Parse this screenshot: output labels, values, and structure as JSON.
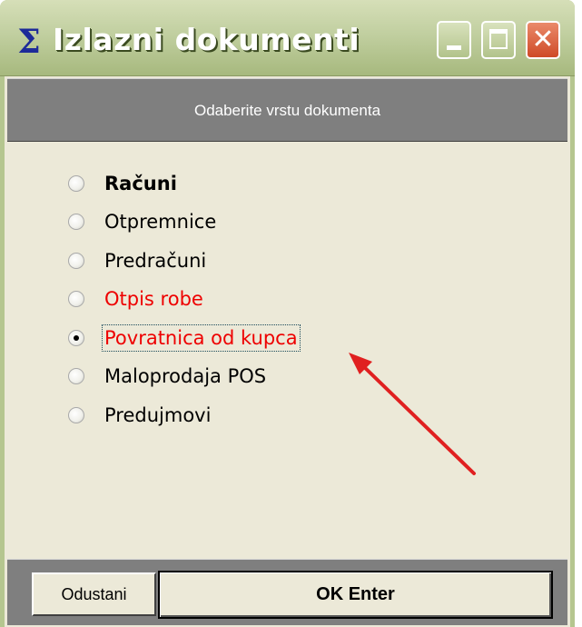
{
  "window": {
    "icon": "sigma-icon",
    "icon_glyph": "Σ",
    "title": "Izlazni dokumenti",
    "minimize_icon": "minimize-icon",
    "maximize_icon": "maximize-icon",
    "close_icon": "close-icon",
    "close_glyph": "✕"
  },
  "header": {
    "text": "Odaberite vrstu dokumenta"
  },
  "options": [
    {
      "label": "Računi",
      "selected": false,
      "color": "#000000",
      "bold": true
    },
    {
      "label": "Otpremnice",
      "selected": false,
      "color": "#000000"
    },
    {
      "label": "Predračuni",
      "selected": false,
      "color": "#000000"
    },
    {
      "label": "Otpis robe",
      "selected": false,
      "color": "#ee0000"
    },
    {
      "label": "Povratnica od kupca",
      "selected": true,
      "color": "#ee0000",
      "focused": true
    },
    {
      "label": "Maloprodaja POS",
      "selected": false,
      "color": "#000000"
    },
    {
      "label": "Predujmovi",
      "selected": false,
      "color": "#000000"
    }
  ],
  "annotation": {
    "icon": "red-arrow-icon",
    "color": "#e02020"
  },
  "buttons": {
    "cancel_label": "Odustani",
    "ok_label": "OK Enter"
  },
  "colors": {
    "titlebar": "#b5c68f",
    "panel": "#7f7f7f",
    "client": "#ece9d8"
  }
}
